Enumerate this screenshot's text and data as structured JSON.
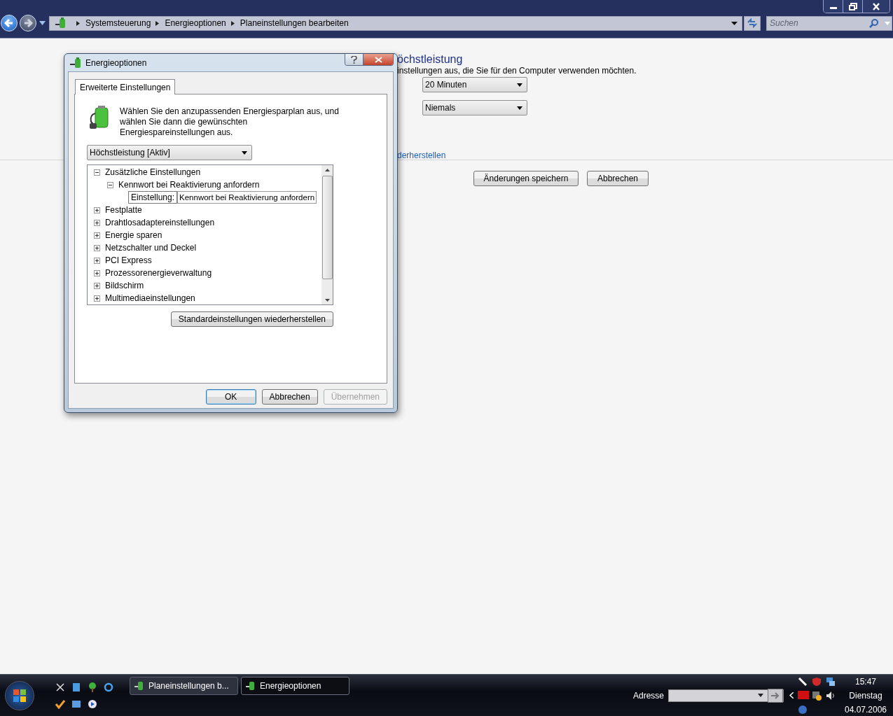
{
  "explorer": {
    "breadcrumb": [
      "Systemsteuerung",
      "Energieoptionen",
      "Planeinstellungen bearbeiten"
    ],
    "search": {
      "placeholder": "Suchen"
    }
  },
  "page": {
    "title": "öchstleistung",
    "description": "instellungen aus, die Sie für den Computer verwenden möchten.",
    "dropdowns": [
      "20 Minuten",
      "Niemals"
    ],
    "link": "derherstellen",
    "buttons": [
      "Änderungen speichern",
      "Abbrechen"
    ]
  },
  "dialog": {
    "title": "Energieoptionen",
    "tabs": [
      {
        "label": "Erweiterte Einstellungen",
        "selected": true
      }
    ],
    "intro": "Wählen Sie den anzupassenden Energiesparplan aus, und wählen Sie dann die gewünschten Energiespareinstellungen aus.",
    "plan": "Höchstleistung [Aktiv]",
    "tree": [
      {
        "label": "Zusätzliche Einstellungen",
        "expanded": true,
        "children": [
          {
            "label": "Kennwort bei Reaktivierung anfordern",
            "expanded": true,
            "setting": {
              "label": "Einstellung:",
              "value": "Kennwort bei Reaktivierung anfordern"
            }
          }
        ]
      },
      {
        "label": "Festplatte",
        "expanded": false
      },
      {
        "label": "Drahtlosadaptereinstellungen",
        "expanded": false
      },
      {
        "label": "Energie sparen",
        "expanded": false
      },
      {
        "label": "Netzschalter und Deckel",
        "expanded": false
      },
      {
        "label": "PCI Express",
        "expanded": false
      },
      {
        "label": "Prozessorenergieverwaltung",
        "expanded": false
      },
      {
        "label": "Bildschirm",
        "expanded": false
      },
      {
        "label": "Multimediaeinstellungen",
        "expanded": false
      }
    ],
    "restore_button": "Standardeinstellungen wiederherstellen",
    "buttons": [
      {
        "label": "OK",
        "default": true,
        "disabled": false
      },
      {
        "label": "Abbrechen",
        "default": false,
        "disabled": false
      },
      {
        "label": "Übernehmen",
        "default": false,
        "disabled": true
      }
    ]
  },
  "taskbar": {
    "tasks": [
      {
        "label": "Planeinstellungen b...",
        "selected": false
      },
      {
        "label": "Energieoptionen",
        "selected": true
      }
    ],
    "address_label": "Adresse",
    "clock": {
      "time": "15:47",
      "day": "Dienstag",
      "date": "04.07.2006"
    }
  }
}
